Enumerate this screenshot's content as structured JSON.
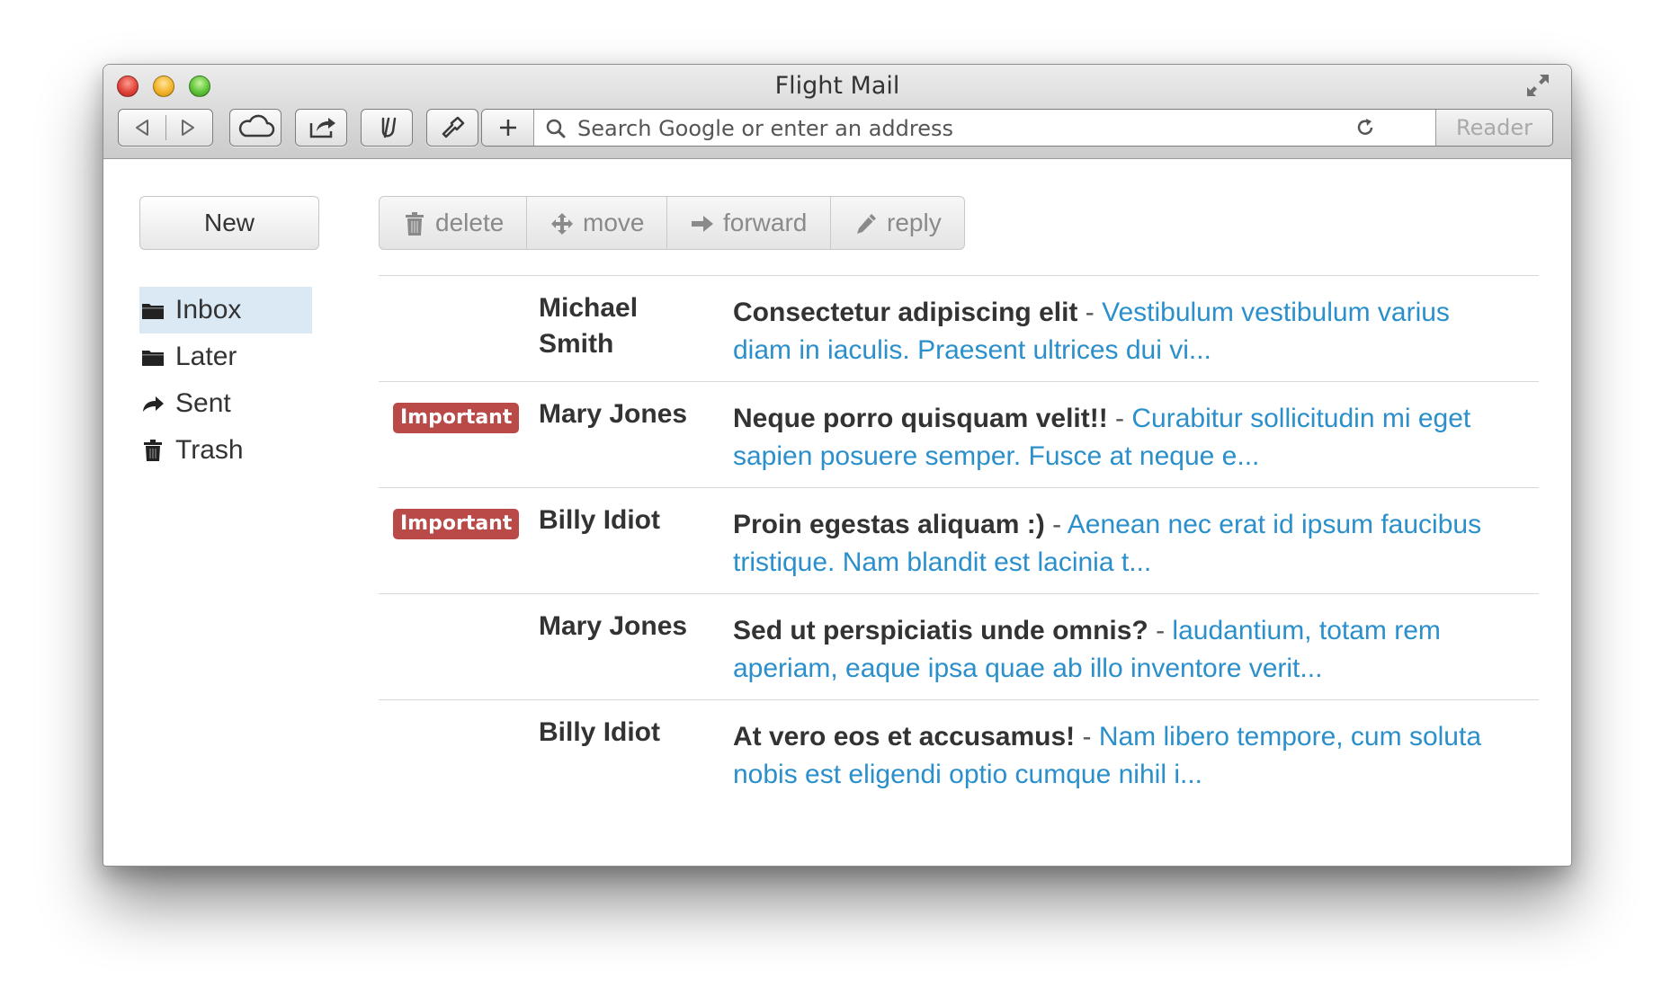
{
  "window": {
    "title": "Flight Mail"
  },
  "toolbar": {
    "search_placeholder": "Search Google or enter an address",
    "reader_label": "Reader"
  },
  "sidebar": {
    "new_label": "New",
    "folders": [
      {
        "label": "Inbox",
        "icon": "folder-icon",
        "active": true
      },
      {
        "label": "Later",
        "icon": "folder-icon",
        "active": false
      },
      {
        "label": "Sent",
        "icon": "share-arrow-icon",
        "active": false
      },
      {
        "label": "Trash",
        "icon": "trash-icon",
        "active": false
      }
    ]
  },
  "actions": {
    "delete": "delete",
    "move": "move",
    "forward": "forward",
    "reply": "reply"
  },
  "messages": [
    {
      "badge": "",
      "sender": "Michael Smith",
      "subject": "Consectetur adipiscing elit",
      "snippet": "Vestibulum vestibulum varius diam in iaculis. Praesent ultrices dui vi..."
    },
    {
      "badge": "Important",
      "sender": "Mary Jones",
      "subject": "Neque porro quisquam velit!!",
      "snippet": "Curabitur sollicitudin mi eget sapien posuere semper. Fusce at neque e..."
    },
    {
      "badge": "Important",
      "sender": "Billy Idiot",
      "subject": "Proin egestas aliquam :)",
      "snippet": "Aenean nec erat id ipsum faucibus tristique. Nam blandit est lacinia t..."
    },
    {
      "badge": "",
      "sender": "Mary Jones",
      "subject": "Sed ut perspiciatis unde omnis?",
      "snippet": "laudantium, totam rem aperiam, eaque ipsa quae ab illo inventore verit..."
    },
    {
      "badge": "",
      "sender": "Billy Idiot",
      "subject": "At vero eos et accusamus!",
      "snippet": "Nam libero tempore, cum soluta nobis est eligendi optio cumque nihil i..."
    }
  ],
  "colors": {
    "badge": "#b94a48",
    "snippet": "#2a8fcb",
    "active_folder": "#dbe9f5"
  }
}
